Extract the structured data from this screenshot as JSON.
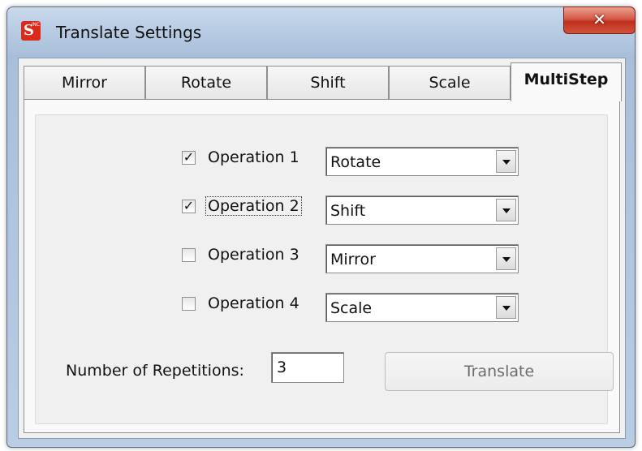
{
  "window": {
    "title": "Translate Settings",
    "close_glyph": "✕",
    "app_icon": {
      "letter": "S",
      "badge": "INC"
    }
  },
  "tabs": [
    {
      "label": "Mirror",
      "active": false
    },
    {
      "label": "Rotate",
      "active": false
    },
    {
      "label": "Shift",
      "active": false
    },
    {
      "label": "Scale",
      "active": false
    },
    {
      "label": "MultiStep",
      "active": true
    }
  ],
  "operations": [
    {
      "label": "Operation 1",
      "checked": true,
      "focused": false,
      "selected": "Rotate"
    },
    {
      "label": "Operation 2",
      "checked": true,
      "focused": true,
      "selected": "Shift"
    },
    {
      "label": "Operation 3",
      "checked": false,
      "focused": false,
      "selected": "Mirror"
    },
    {
      "label": "Operation 4",
      "checked": false,
      "focused": false,
      "selected": "Scale"
    }
  ],
  "check_glyph": "✓",
  "repetitions": {
    "label": "Number of Repetitions:",
    "value": "3"
  },
  "translate_button": {
    "label": "Translate",
    "enabled": false
  },
  "colors": {
    "close_button": "#c0301d",
    "app_icon": "#d92a1c"
  }
}
